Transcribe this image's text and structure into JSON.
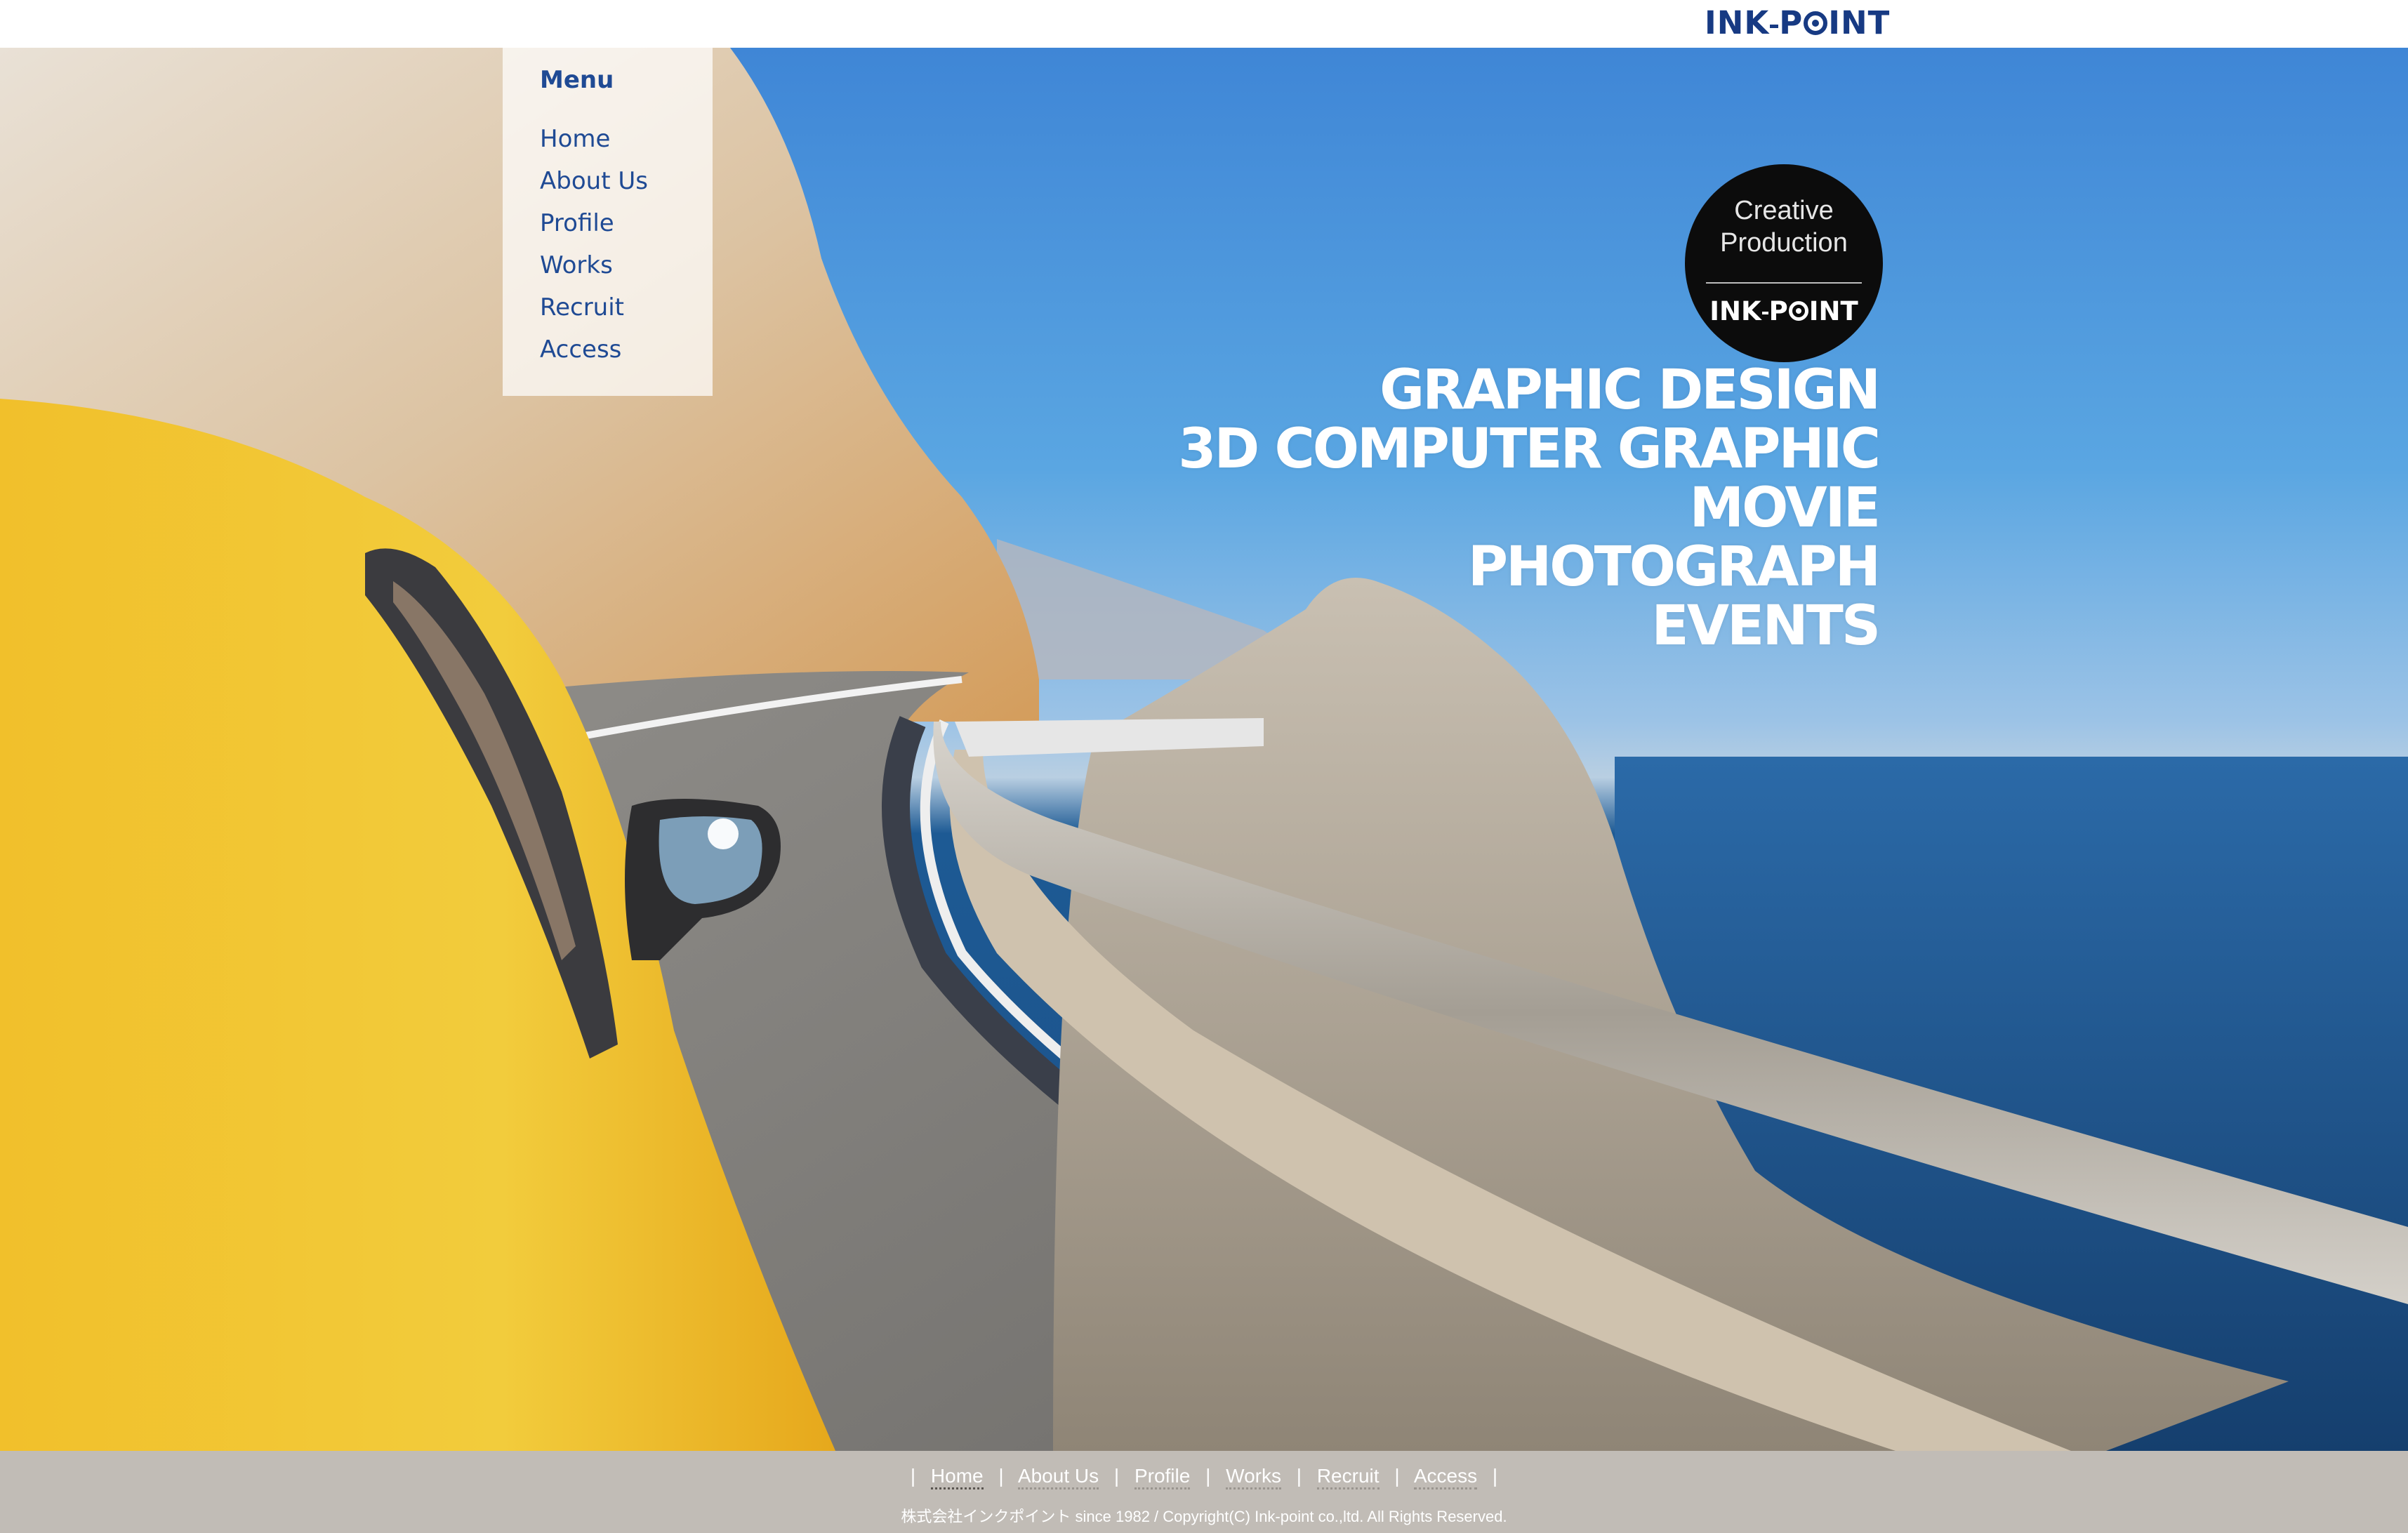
{
  "header": {
    "logo_text_left": "INK",
    "logo_text_right": "INT",
    "logo_alt": "INK-POINT",
    "brand_color": "#173a83"
  },
  "menu": {
    "title": "Menu",
    "items": [
      {
        "label": "Home"
      },
      {
        "label": "About Us"
      },
      {
        "label": "Profile"
      },
      {
        "label": "Works"
      },
      {
        "label": "Recruit"
      },
      {
        "label": "Access"
      }
    ],
    "text_color": "#1f4a94"
  },
  "badge": {
    "line1": "Creative",
    "line2": "Production",
    "logo_left": "INK",
    "logo_right": "INT"
  },
  "services": [
    "GRAPHIC DESIGN",
    "3D COMPUTER GRAPHIC",
    "MOVIE",
    "PHOTOGRAPH",
    "EVENTS"
  ],
  "hero": {
    "image_description": "Yellow car driving on a coastal mountain road beside a guardrail and blue sea"
  },
  "footer": {
    "separator": "|",
    "links": [
      {
        "label": "Home",
        "active": true
      },
      {
        "label": "About Us",
        "active": false
      },
      {
        "label": "Profile",
        "active": false
      },
      {
        "label": "Works",
        "active": false
      },
      {
        "label": "Recruit",
        "active": false
      },
      {
        "label": "Access",
        "active": false
      }
    ],
    "copyright": "株式会社インクポイント since 1982 / Copyright(C) Ink-point co.,ltd. All Rights Reserved.",
    "background": "#c1bcb6"
  }
}
